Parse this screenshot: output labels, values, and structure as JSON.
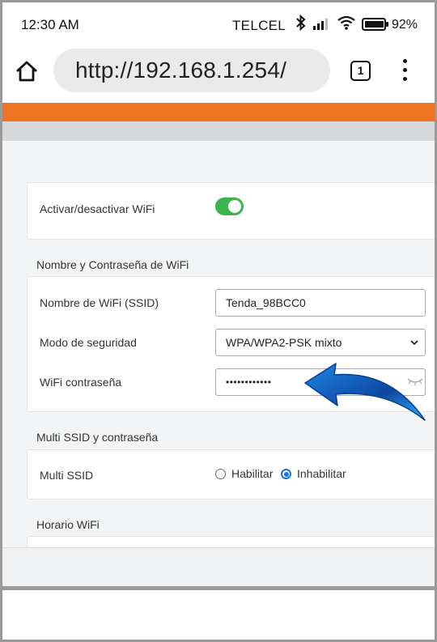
{
  "status_bar": {
    "time": "12:30 AM",
    "carrier": "TELCEL",
    "battery": "92%"
  },
  "browser": {
    "url": "http://192.168.1.254/",
    "tab_count": "1"
  },
  "wifi_toggle": {
    "label": "Activar/desactivar WiFi",
    "enabled": true
  },
  "section_name_password": {
    "title": "Nombre y Contraseña de WiFi",
    "ssid_label": "Nombre de WiFi (SSID)",
    "ssid_value": "Tenda_98BCC0",
    "security_label": "Modo de seguridad",
    "security_value": "WPA/WPA2-PSK mixto",
    "password_label": "WiFi contraseña",
    "password_value": "••••••••••••"
  },
  "section_multi_ssid": {
    "title": "Multi SSID y contraseña",
    "label": "Multi SSID",
    "options": [
      "Habilitar",
      "Inhabilitar"
    ],
    "selected": "Inhabilitar"
  },
  "section_schedule": {
    "title": "Horario WiFi"
  },
  "colors": {
    "accent_orange": "#ee7322",
    "toggle_green": "#3bb54a",
    "radio_blue": "#1a73e8",
    "arrow_blue": "#1565d8"
  }
}
